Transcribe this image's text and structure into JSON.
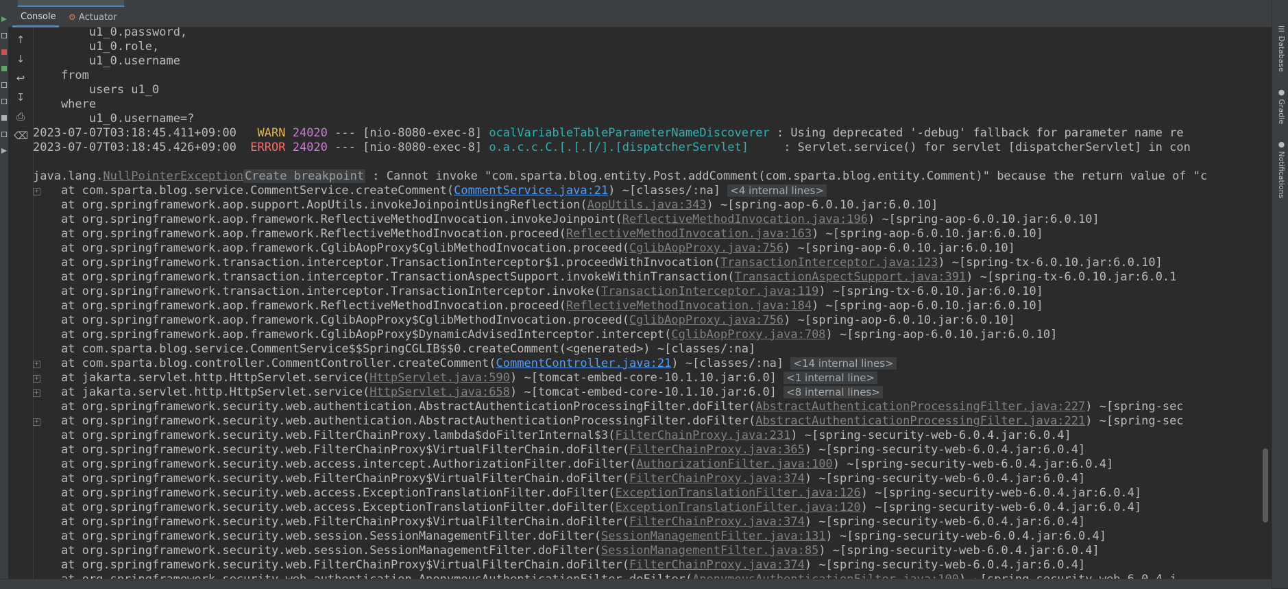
{
  "tool_window": {
    "tabs": [
      {
        "label": "Console",
        "active": true
      },
      {
        "label": "Actuator",
        "active": false
      }
    ],
    "right_sidebar": [
      "Database",
      "Gradle",
      "Notifications"
    ]
  },
  "toolbar": {
    "icons": [
      "arrow-up-icon",
      "arrow-down-icon",
      "soft-wrap-icon",
      "scroll-to-end-icon",
      "print-icon",
      "trash-icon"
    ]
  },
  "colors": {
    "background": "#2b2b2b",
    "warn": "#e6b450",
    "error": "#ff6b68",
    "pid": "#cc7bd6",
    "logger": "#2fb1b6",
    "link": "#589df6"
  },
  "console": {
    "sql": [
      "        u1_0.password,",
      "        u1_0.role,",
      "        u1_0.username",
      "    from",
      "        users u1_0",
      "    where",
      "        u1_0.username=?"
    ],
    "logs": [
      {
        "timestamp": "2023-07-07T03:18:45.411+09:00",
        "level": " WARN",
        "pid": "24020",
        "mid": " --- [nio-8080-exec-8] ",
        "logger": "ocalVariableTableParameterNameDiscoverer",
        "message": " : Using deprecated '-debug' fallback for parameter name re"
      },
      {
        "timestamp": "2023-07-07T03:18:45.426+09:00",
        "level": "ERROR",
        "pid": "24020",
        "mid": " --- [nio-8080-exec-8] ",
        "logger": "o.a.c.c.C.[.[.[/].[dispatcherServlet]    ",
        "message": " : Servlet.service() for servlet [dispatcherServlet] in con"
      }
    ],
    "exception": {
      "prefix": "java.lang.",
      "class": "NullPointerException",
      "hint": "Create breakpoint",
      "message": " : Cannot invoke \"com.sparta.blog.entity.Post.addComment(com.sparta.blog.entity.Comment)\" because the return value of \"c"
    },
    "stack": [
      {
        "fold": true,
        "pre": "    at com.sparta.blog.service.CommentService.createComment(",
        "link": "CommentService.java:21",
        "primary": true,
        "post": ") ~[classes/:na] ",
        "badge": "<4 internal lines>"
      },
      {
        "fold": false,
        "pre": "    at org.springframework.aop.support.AopUtils.invokeJoinpointUsingReflection(",
        "link": "AopUtils.java:343",
        "primary": false,
        "post": ") ~[spring-aop-6.0.10.jar:6.0.10]",
        "badge": ""
      },
      {
        "fold": false,
        "pre": "    at org.springframework.aop.framework.ReflectiveMethodInvocation.invokeJoinpoint(",
        "link": "ReflectiveMethodInvocation.java:196",
        "primary": false,
        "post": ") ~[spring-aop-6.0.10.jar:6.0.10]",
        "badge": ""
      },
      {
        "fold": false,
        "pre": "    at org.springframework.aop.framework.ReflectiveMethodInvocation.proceed(",
        "link": "ReflectiveMethodInvocation.java:163",
        "primary": false,
        "post": ") ~[spring-aop-6.0.10.jar:6.0.10]",
        "badge": ""
      },
      {
        "fold": false,
        "pre": "    at org.springframework.aop.framework.CglibAopProxy$CglibMethodInvocation.proceed(",
        "link": "CglibAopProxy.java:756",
        "primary": false,
        "post": ") ~[spring-aop-6.0.10.jar:6.0.10]",
        "badge": ""
      },
      {
        "fold": false,
        "pre": "    at org.springframework.transaction.interceptor.TransactionInterceptor$1.proceedWithInvocation(",
        "link": "TransactionInterceptor.java:123",
        "primary": false,
        "post": ") ~[spring-tx-6.0.10.jar:6.0.10]",
        "badge": ""
      },
      {
        "fold": false,
        "pre": "    at org.springframework.transaction.interceptor.TransactionAspectSupport.invokeWithinTransaction(",
        "link": "TransactionAspectSupport.java:391",
        "primary": false,
        "post": ") ~[spring-tx-6.0.10.jar:6.0.1",
        "badge": ""
      },
      {
        "fold": false,
        "pre": "    at org.springframework.transaction.interceptor.TransactionInterceptor.invoke(",
        "link": "TransactionInterceptor.java:119",
        "primary": false,
        "post": ") ~[spring-tx-6.0.10.jar:6.0.10]",
        "badge": ""
      },
      {
        "fold": false,
        "pre": "    at org.springframework.aop.framework.ReflectiveMethodInvocation.proceed(",
        "link": "ReflectiveMethodInvocation.java:184",
        "primary": false,
        "post": ") ~[spring-aop-6.0.10.jar:6.0.10]",
        "badge": ""
      },
      {
        "fold": false,
        "pre": "    at org.springframework.aop.framework.CglibAopProxy$CglibMethodInvocation.proceed(",
        "link": "CglibAopProxy.java:756",
        "primary": false,
        "post": ") ~[spring-aop-6.0.10.jar:6.0.10]",
        "badge": ""
      },
      {
        "fold": false,
        "pre": "    at org.springframework.aop.framework.CglibAopProxy$DynamicAdvisedInterceptor.intercept(",
        "link": "CglibAopProxy.java:708",
        "primary": false,
        "post": ") ~[spring-aop-6.0.10.jar:6.0.10]",
        "badge": ""
      },
      {
        "fold": false,
        "pre": "    at com.sparta.blog.service.CommentService$$SpringCGLIB$$0.createComment(<generated>) ~[classes/:na]",
        "link": "",
        "primary": false,
        "post": "",
        "badge": ""
      },
      {
        "fold": true,
        "pre": "    at com.sparta.blog.controller.CommentController.createComment(",
        "link": "CommentController.java:21",
        "primary": true,
        "post": ") ~[classes/:na] ",
        "badge": "<14 internal lines>"
      },
      {
        "fold": true,
        "pre": "    at jakarta.servlet.http.HttpServlet.service(",
        "link": "HttpServlet.java:590",
        "primary": false,
        "post": ") ~[tomcat-embed-core-10.1.10.jar:6.0] ",
        "badge": "<1 internal line>"
      },
      {
        "fold": true,
        "pre": "    at jakarta.servlet.http.HttpServlet.service(",
        "link": "HttpServlet.java:658",
        "primary": false,
        "post": ") ~[tomcat-embed-core-10.1.10.jar:6.0] ",
        "badge": "<8 internal lines>"
      },
      {
        "fold": false,
        "pre": "    at org.springframework.security.web.authentication.AbstractAuthenticationProcessingFilter.doFilter(",
        "link": "AbstractAuthenticationProcessingFilter.java:227",
        "primary": false,
        "post": ") ~[spring-sec",
        "badge": ""
      },
      {
        "fold": true,
        "pre": "    at org.springframework.security.web.authentication.AbstractAuthenticationProcessingFilter.doFilter(",
        "link": "AbstractAuthenticationProcessingFilter.java:221",
        "primary": false,
        "post": ") ~[spring-sec",
        "badge": ""
      },
      {
        "fold": false,
        "pre": "    at org.springframework.security.web.FilterChainProxy.lambda$doFilterInternal$3(",
        "link": "FilterChainProxy.java:231",
        "primary": false,
        "post": ") ~[spring-security-web-6.0.4.jar:6.0.4]",
        "badge": ""
      },
      {
        "fold": false,
        "pre": "    at org.springframework.security.web.FilterChainProxy$VirtualFilterChain.doFilter(",
        "link": "FilterChainProxy.java:365",
        "primary": false,
        "post": ") ~[spring-security-web-6.0.4.jar:6.0.4]",
        "badge": ""
      },
      {
        "fold": false,
        "pre": "    at org.springframework.security.web.access.intercept.AuthorizationFilter.doFilter(",
        "link": "AuthorizationFilter.java:100",
        "primary": false,
        "post": ") ~[spring-security-web-6.0.4.jar:6.0.4]",
        "badge": ""
      },
      {
        "fold": false,
        "pre": "    at org.springframework.security.web.FilterChainProxy$VirtualFilterChain.doFilter(",
        "link": "FilterChainProxy.java:374",
        "primary": false,
        "post": ") ~[spring-security-web-6.0.4.jar:6.0.4]",
        "badge": ""
      },
      {
        "fold": false,
        "pre": "    at org.springframework.security.web.access.ExceptionTranslationFilter.doFilter(",
        "link": "ExceptionTranslationFilter.java:126",
        "primary": false,
        "post": ") ~[spring-security-web-6.0.4.jar:6.0.4]",
        "badge": ""
      },
      {
        "fold": false,
        "pre": "    at org.springframework.security.web.access.ExceptionTranslationFilter.doFilter(",
        "link": "ExceptionTranslationFilter.java:120",
        "primary": false,
        "post": ") ~[spring-security-web-6.0.4.jar:6.0.4]",
        "badge": ""
      },
      {
        "fold": false,
        "pre": "    at org.springframework.security.web.FilterChainProxy$VirtualFilterChain.doFilter(",
        "link": "FilterChainProxy.java:374",
        "primary": false,
        "post": ") ~[spring-security-web-6.0.4.jar:6.0.4]",
        "badge": ""
      },
      {
        "fold": false,
        "pre": "    at org.springframework.security.web.session.SessionManagementFilter.doFilter(",
        "link": "SessionManagementFilter.java:131",
        "primary": false,
        "post": ") ~[spring-security-web-6.0.4.jar:6.0.4]",
        "badge": ""
      },
      {
        "fold": false,
        "pre": "    at org.springframework.security.web.session.SessionManagementFilter.doFilter(",
        "link": "SessionManagementFilter.java:85",
        "primary": false,
        "post": ") ~[spring-security-web-6.0.4.jar:6.0.4]",
        "badge": ""
      },
      {
        "fold": false,
        "pre": "    at org.springframework.security.web.FilterChainProxy$VirtualFilterChain.doFilter(",
        "link": "FilterChainProxy.java:374",
        "primary": false,
        "post": ") ~[spring-security-web-6.0.4.jar:6.0.4]",
        "badge": ""
      },
      {
        "fold": false,
        "pre": "    at org.springframework.security.web.authentication.AnonymousAuthenticationFilter.doFilter(",
        "link": "AnonymousAuthenticationFilter.java:100",
        "primary": false,
        "post": ") ~[spring-security-web-6.0.4.j",
        "badge": ""
      }
    ]
  }
}
